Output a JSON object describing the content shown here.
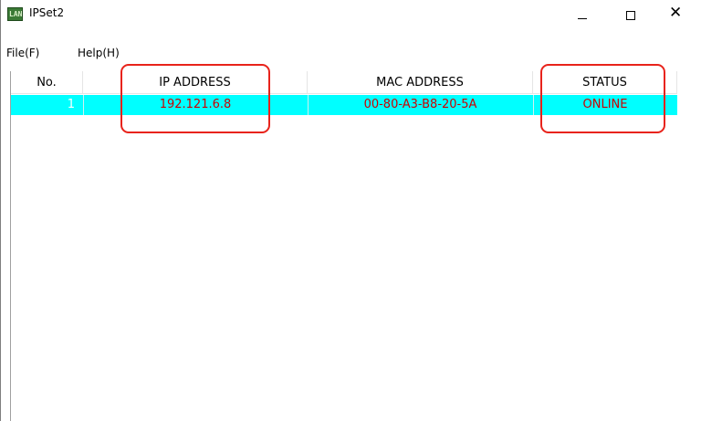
{
  "window": {
    "title": "IPSet2",
    "icon_name": "lan-icon",
    "icon_text": "LAN",
    "minimize_glyph": "minimize-icon",
    "maximize_glyph": "maximize-icon",
    "close_glyph": "✕"
  },
  "menu": {
    "file_label": "File(F)",
    "help_label": "Help(H)"
  },
  "table": {
    "headers": {
      "no": "No.",
      "ip": "IP ADDRESS",
      "mac": "MAC ADDRESS",
      "status": "STATUS"
    },
    "rows": [
      {
        "no": "1",
        "ip": "192.121.6.8",
        "mac": "00-80-A3-B8-20-5A",
        "status": "ONLINE"
      }
    ]
  },
  "colors": {
    "selected_row_bg": "#00ffff",
    "row_text": "#cc0000",
    "highlight_border": "#e8231b"
  }
}
